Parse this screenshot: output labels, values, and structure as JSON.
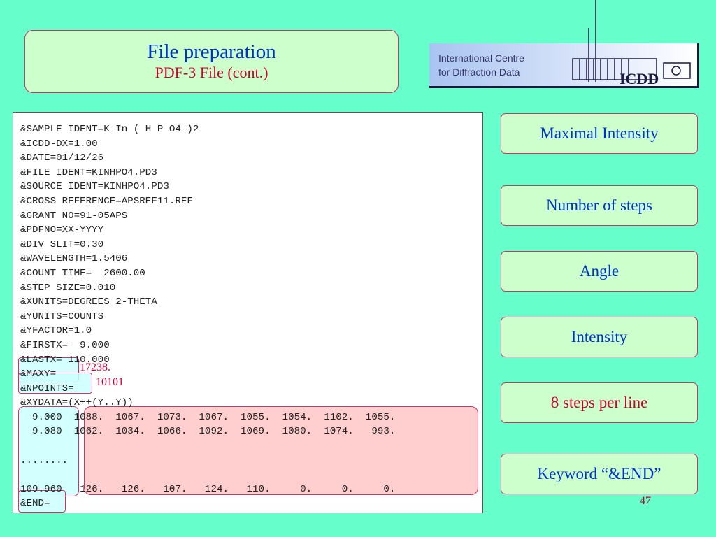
{
  "title": {
    "main": "File preparation",
    "sub": "PDF-3 File (cont.)"
  },
  "logo": {
    "line1": "International Centre",
    "line2": "for Diffraction Data",
    "mark": "ICDD"
  },
  "code_lines": [
    "&SAMPLE IDENT=K In ( H P O4 )2",
    "&ICDD-DX=1.00",
    "&DATE=01/12/26",
    "&FILE IDENT=KINHPO4.PD3",
    "&SOURCE IDENT=KINHPO4.PD3",
    "&CROSS REFERENCE=APSREF11.REF",
    "&GRANT NO=91-05APS",
    "&PDFNO=XX-YYYY",
    "&DIV SLIT=0.30",
    "&WAVELENGTH=1.5406",
    "&COUNT TIME=  2600.00",
    "&STEP SIZE=0.010",
    "&XUNITS=DEGREES 2-THETA",
    "&YUNITS=COUNTS",
    "&YFACTOR=1.0",
    "&FIRSTX=  9.000",
    "&LASTX= 110.000",
    "&MAXY=",
    "&NPOINTS=",
    "&XYDATA=(X++(Y..Y))",
    "  9.000  1088.  1067.  1073.  1067.  1055.  1054.  1102.  1055.",
    "  9.080  1062.  1034.  1066.  1092.  1069.  1080.  1074.   993.",
    "",
    "........",
    "",
    "109.960   126.   126.   107.   124.   110.     0.     0.     0.",
    "&END="
  ],
  "annotations": {
    "maxy_value": "17238.",
    "npoints_value": "10101"
  },
  "side_buttons": [
    "Maximal Intensity",
    "Number of steps",
    "Angle",
    "Intensity",
    "8 steps per line",
    "Keyword “&END”"
  ],
  "page_number": "47",
  "colors": {
    "background": "#66ffcc",
    "box_fill": "#ccffcc",
    "title_blue": "#0033cc",
    "accent_red": "#cc0033",
    "border": "#cc3366",
    "highlight_pink": "#ffcccc",
    "highlight_cyan": "#ccffff"
  }
}
